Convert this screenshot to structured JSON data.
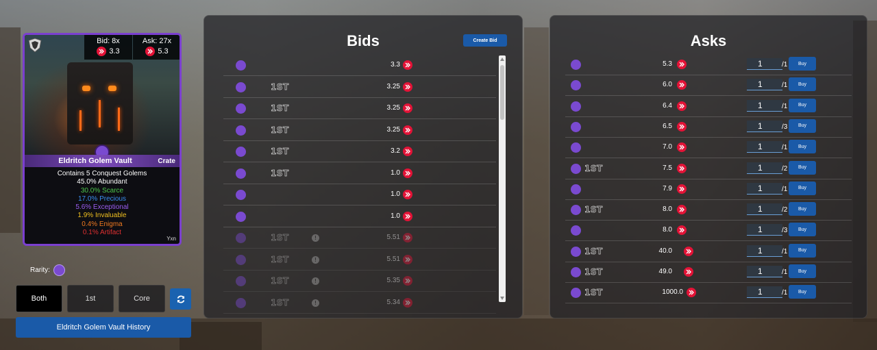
{
  "card": {
    "bid_label": "Bid: 8x",
    "bid_value": "3.3",
    "ask_label": "Ask: 27x",
    "ask_value": "5.3",
    "name": "Eldritch Golem Vault",
    "type": "Crate",
    "contents": "Contains 5 Conquest Golems",
    "odds": [
      {
        "text": "45.0% Abundant",
        "color": "#ffffff"
      },
      {
        "text": "30.0% Scarce",
        "color": "#4ec84e"
      },
      {
        "text": "17.0% Precious",
        "color": "#3a8ef0"
      },
      {
        "text": "5.6% Exceptional",
        "color": "#9a5cf0"
      },
      {
        "text": "1.9% Invaluable",
        "color": "#f0c020"
      },
      {
        "text": "0.4% Enigma",
        "color": "#f07a20"
      },
      {
        "text": "0.1% Artifact",
        "color": "#e03030"
      }
    ],
    "author": "Yxn"
  },
  "rarity_label": "Rarity:",
  "filters": {
    "both": "Both",
    "first": "1st",
    "core": "Core"
  },
  "history_button": "Eldritch Golem Vault History",
  "bids": {
    "title": "Bids",
    "create_label": "Create Bid",
    "rows": [
      {
        "tag": "",
        "price": "3.3",
        "dim": false,
        "info": false
      },
      {
        "tag": "1ST",
        "price": "3.25",
        "dim": false,
        "info": false
      },
      {
        "tag": "1ST",
        "price": "3.25",
        "dim": false,
        "info": false
      },
      {
        "tag": "1ST",
        "price": "3.25",
        "dim": false,
        "info": false
      },
      {
        "tag": "1ST",
        "price": "3.2",
        "dim": false,
        "info": false
      },
      {
        "tag": "1ST",
        "price": "1.0",
        "dim": false,
        "info": false
      },
      {
        "tag": "",
        "price": "1.0",
        "dim": false,
        "info": false
      },
      {
        "tag": "",
        "price": "1.0",
        "dim": false,
        "info": false
      },
      {
        "tag": "1ST",
        "price": "5.51",
        "dim": true,
        "info": true
      },
      {
        "tag": "1ST",
        "price": "5.51",
        "dim": true,
        "info": true
      },
      {
        "tag": "1ST",
        "price": "5.35",
        "dim": true,
        "info": true
      },
      {
        "tag": "1ST",
        "price": "5.34",
        "dim": true,
        "info": true
      }
    ]
  },
  "asks": {
    "title": "Asks",
    "buy_label": "Buy",
    "rows": [
      {
        "tag": "",
        "price": "5.3",
        "qty": "1",
        "of": "/1"
      },
      {
        "tag": "",
        "price": "6.0",
        "qty": "1",
        "of": "/1"
      },
      {
        "tag": "",
        "price": "6.4",
        "qty": "1",
        "of": "/1"
      },
      {
        "tag": "",
        "price": "6.5",
        "qty": "1",
        "of": "/3"
      },
      {
        "tag": "",
        "price": "7.0",
        "qty": "1",
        "of": "/1"
      },
      {
        "tag": "1ST",
        "price": "7.5",
        "qty": "1",
        "of": "/2"
      },
      {
        "tag": "",
        "price": "7.9",
        "qty": "1",
        "of": "/1"
      },
      {
        "tag": "1ST",
        "price": "8.0",
        "qty": "1",
        "of": "/2"
      },
      {
        "tag": "",
        "price": "8.0",
        "qty": "1",
        "of": "/3"
      },
      {
        "tag": "1ST",
        "price": "40.0",
        "qty": "1",
        "of": "/1"
      },
      {
        "tag": "1ST",
        "price": "49.0",
        "qty": "1",
        "of": "/1"
      },
      {
        "tag": "1ST",
        "price": "1000.0",
        "qty": "1",
        "of": "/1"
      }
    ]
  },
  "colors": {
    "accent": "#1a5aa8",
    "rarity": "#7a4ad0",
    "hive": "#e31337"
  }
}
